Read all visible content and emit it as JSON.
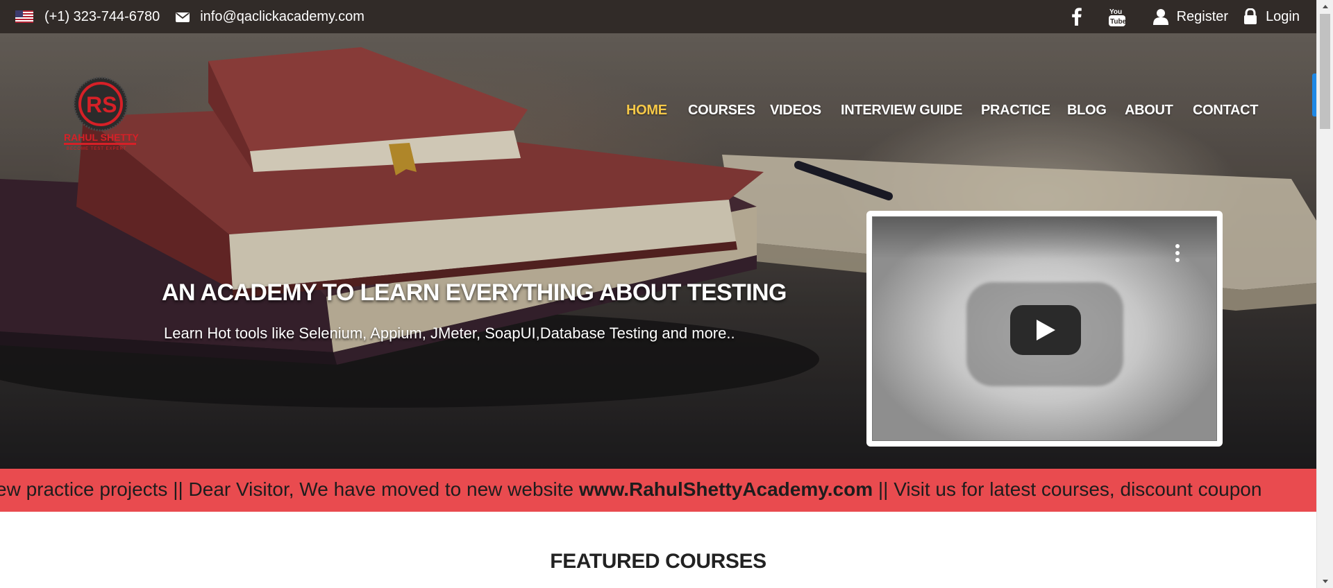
{
  "topbar": {
    "phone": "(+1) 323-744-6780",
    "email": "info@qaclickacademy.com",
    "register": "Register",
    "login": "Login",
    "icons": [
      "us-flag-icon",
      "envelope-icon",
      "facebook-icon",
      "youtube-icon",
      "user-icon",
      "lock-icon"
    ],
    "background": "#312b28"
  },
  "logo": {
    "letters": "RS",
    "name": "RAHUL SHETTY",
    "tagline": "BECOME TEST EXPERT",
    "color": "#d62027"
  },
  "nav": {
    "items": [
      {
        "label": "HOME",
        "active": true
      },
      {
        "label": "COURSES"
      },
      {
        "label": "VIDEOS"
      },
      {
        "label": "INTERVIEW GUIDE"
      },
      {
        "label": "PRACTICE"
      },
      {
        "label": "BLOG"
      },
      {
        "label": "ABOUT"
      },
      {
        "label": "CONTACT"
      }
    ],
    "active_color": "#f7c948"
  },
  "hero": {
    "headline": "AN ACADEMY TO LEARN EVERYTHING ABOUT TESTING",
    "subline": "Learn Hot tools like Selenium, Appium, JMeter, SoapUI,Database Testing and more.."
  },
  "video": {
    "icons": [
      "play-icon",
      "more-options-icon"
    ]
  },
  "marquee": {
    "before": "ew practice projects || Dear Visitor, We have moved to new website ",
    "link": "www.RahulShettyAcademy.com",
    "after": " || Visit us for latest courses, discount coupon",
    "background": "#e94b4f"
  },
  "featured": {
    "title": "FEATURED COURSES"
  }
}
